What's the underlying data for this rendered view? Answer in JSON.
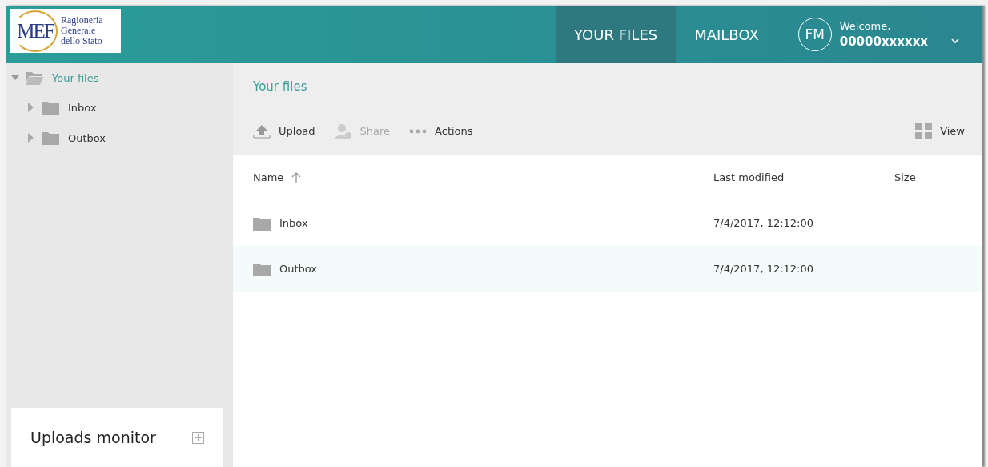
{
  "header": {
    "logo": {
      "mark": "MEF",
      "lines": [
        "Ragioneria",
        "Generale",
        "dello Stato"
      ]
    },
    "tabs": [
      {
        "label": "YOUR FILES",
        "selected": true
      },
      {
        "label": "MAILBOX",
        "selected": false
      }
    ],
    "user": {
      "initials": "FM",
      "greeting": "Welcome,",
      "name": "00000xxxxxx"
    }
  },
  "sidebar": {
    "tree": [
      {
        "label": "Your files",
        "expanded": true,
        "selected": true,
        "children": [
          {
            "label": "Inbox",
            "expanded": false,
            "selected": false
          },
          {
            "label": "Outbox",
            "expanded": false,
            "selected": false
          }
        ]
      }
    ],
    "uploads_monitor": {
      "title": "Uploads monitor"
    }
  },
  "main": {
    "breadcrumb": "Your files",
    "toolbar": [
      {
        "kind": "upload",
        "label": "Upload",
        "disabled": false
      },
      {
        "kind": "share",
        "label": "Share",
        "disabled": true
      },
      {
        "kind": "actions",
        "label": "Actions",
        "disabled": false
      }
    ],
    "view_button": {
      "label": "View"
    },
    "table": {
      "columns": [
        {
          "label": "Name",
          "sorted": true
        },
        {
          "label": "Last modified",
          "sorted": false
        },
        {
          "label": "Size",
          "sorted": false
        }
      ],
      "rows": [
        {
          "name": "Inbox",
          "modified": "7/4/2017, 12:12:00",
          "selected": false
        },
        {
          "name": "Outbox",
          "modified": "7/4/2017, 12:12:00",
          "selected": true
        }
      ]
    }
  }
}
